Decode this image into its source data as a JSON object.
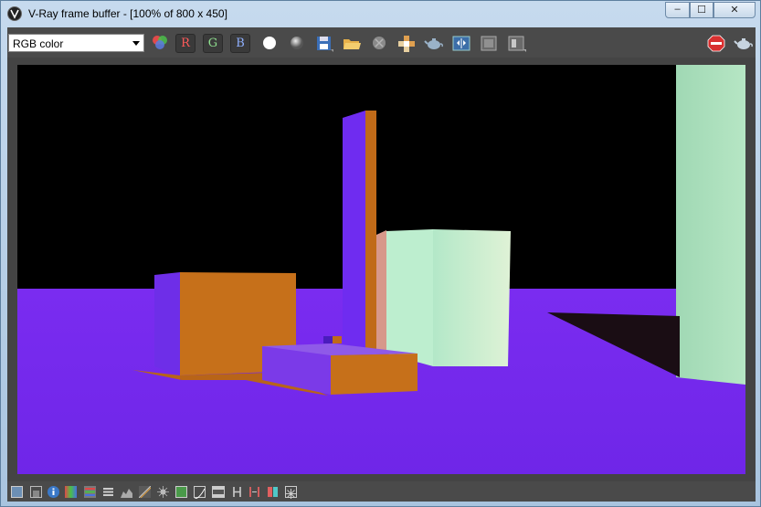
{
  "window": {
    "title": "V-Ray frame buffer - [100% of 800 x 450]"
  },
  "window_controls": {
    "minimize": "–",
    "maximize": "☐",
    "close": "✕"
  },
  "toolbar": {
    "channel_value": "RGB color",
    "r_label": "R",
    "g_label": "G",
    "b_label": "B"
  },
  "colors": {
    "floor": "#7a2cf0",
    "wall": "#a6d9b7",
    "orange": "#c46f19",
    "sky": "#000000"
  }
}
